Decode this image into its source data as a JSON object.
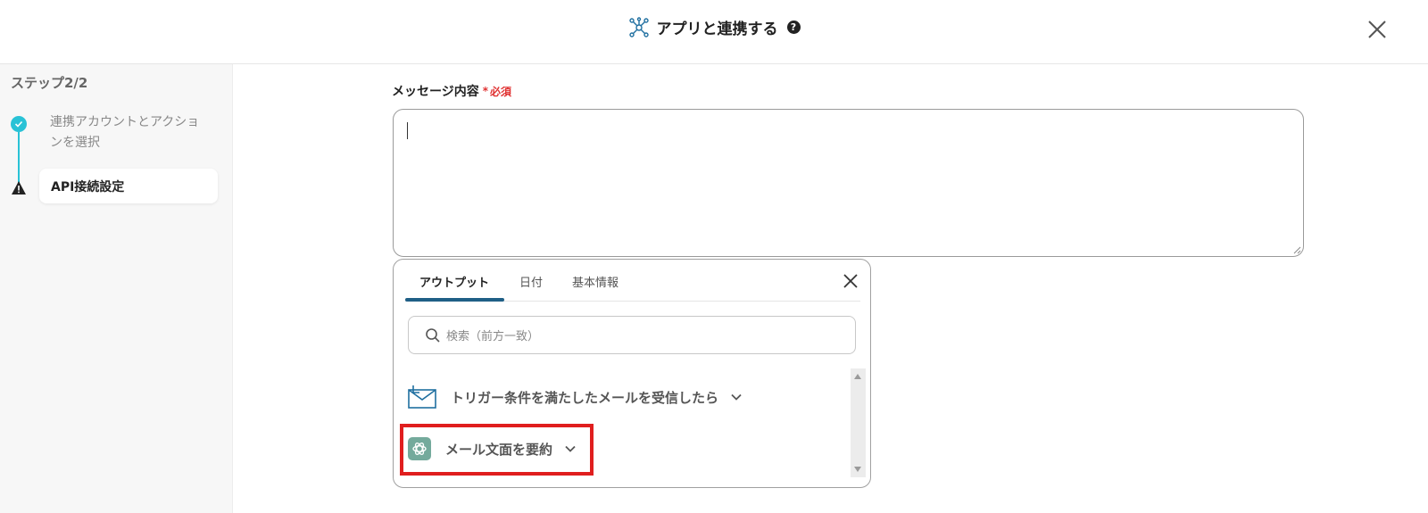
{
  "header": {
    "title": "アプリと連携する",
    "help": "?"
  },
  "sidebar": {
    "step_title": "ステップ2/2",
    "steps": [
      {
        "label": "連携アカウントとアクションを選択",
        "status": "complete"
      },
      {
        "label": "API接続設定",
        "status": "warning"
      }
    ]
  },
  "field": {
    "label": "メッセージ内容",
    "required_label": "必須",
    "value": ""
  },
  "popup": {
    "tabs": [
      {
        "label": "アウトプット",
        "active": true
      },
      {
        "label": "日付",
        "active": false
      },
      {
        "label": "基本情報",
        "active": false
      }
    ],
    "search_placeholder": "検索（前方一致）",
    "items": [
      {
        "label": "トリガー条件を満たしたメールを受信したら",
        "icon": "mail-icon"
      },
      {
        "label": "メール文面を要約",
        "icon": "chatgpt-icon"
      }
    ]
  },
  "colors": {
    "accent": "#29c2d6",
    "tab_underline": "#1f5f86",
    "required": "#e03131",
    "highlight": "#e01e1e"
  }
}
